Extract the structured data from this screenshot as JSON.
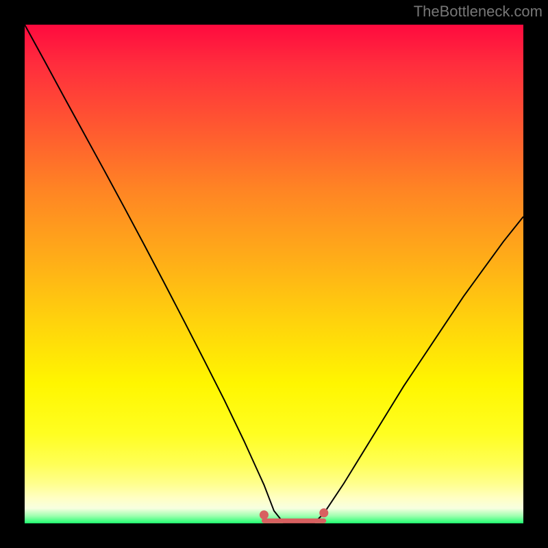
{
  "attribution": "TheBottleneck.com",
  "chart_data": {
    "type": "line",
    "title": "",
    "xlabel": "",
    "ylabel": "",
    "xlim": [
      0,
      100
    ],
    "ylim": [
      0,
      100
    ],
    "x": [
      0,
      4,
      8,
      12,
      16,
      20,
      24,
      28,
      32,
      36,
      40,
      44,
      48,
      50,
      52,
      54,
      56,
      58,
      60,
      64,
      68,
      72,
      76,
      80,
      84,
      88,
      92,
      96,
      100
    ],
    "values": [
      100.0,
      92.7,
      85.3,
      78.0,
      70.7,
      63.3,
      55.8,
      48.2,
      40.5,
      32.7,
      24.8,
      16.5,
      7.7,
      2.5,
      0.0,
      0.0,
      0.0,
      0.0,
      2.0,
      8.0,
      14.5,
      21.0,
      27.5,
      33.5,
      39.5,
      45.5,
      51.0,
      56.5,
      61.5
    ],
    "annotations": [
      {
        "type": "highlight-band",
        "x_start": 48,
        "x_end": 60,
        "baseline": 0,
        "color": "#d86060"
      }
    ]
  },
  "colors": {
    "page_bg": "#000000",
    "curve": "#000000",
    "highlight": "#d86060",
    "attribution": "#777777"
  }
}
